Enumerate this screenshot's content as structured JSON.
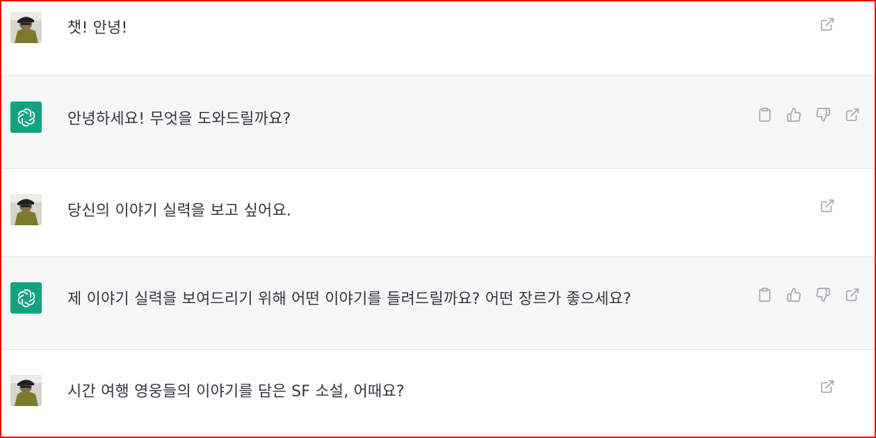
{
  "conversation": {
    "messages": [
      {
        "role": "user",
        "text": "챗! 안녕!",
        "actions": [
          "share-icon"
        ]
      },
      {
        "role": "assistant",
        "text": "안녕하세요! 무엇을 도와드릴까요?",
        "actions": [
          "clipboard-icon",
          "thumbs-up-icon",
          "thumbs-down-icon",
          "share-icon"
        ]
      },
      {
        "role": "user",
        "text": "당신의 이야기 실력을 보고 싶어요.",
        "actions": [
          "share-icon"
        ]
      },
      {
        "role": "assistant",
        "text": "제 이야기 실력을 보여드리기 위해 어떤 이야기를 들려드릴까요? 어떤 장르가 좋으세요?",
        "actions": [
          "clipboard-icon",
          "thumbs-up-icon",
          "thumbs-down-icon",
          "share-icon"
        ]
      },
      {
        "role": "user",
        "text": "시간 여행 영웅들의 이야기를 담은 SF 소설, 어때요?",
        "actions": [
          "share-icon"
        ]
      }
    ]
  },
  "colors": {
    "assistant_bg": "#f7f7f8",
    "bot_avatar": "#10a37f",
    "text": "#343541",
    "icon": "#a9a9b4",
    "frame_border": "#ee0000"
  }
}
